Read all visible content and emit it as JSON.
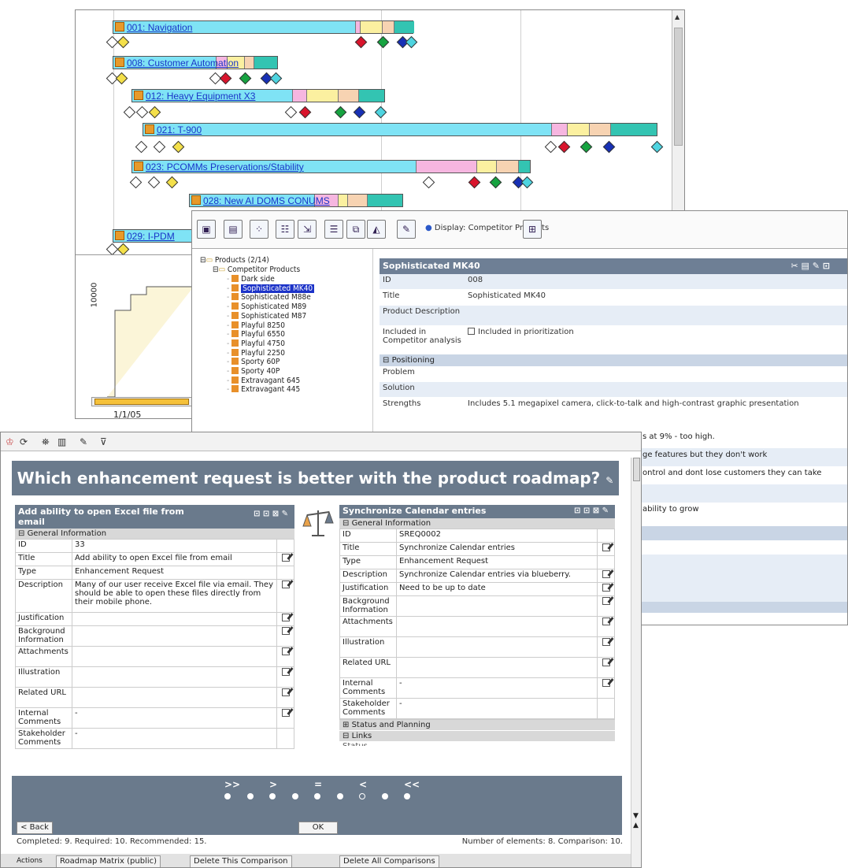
{
  "gantt": {
    "projects": [
      {
        "label": "001: Navigation"
      },
      {
        "label": "008: Customer Automation"
      },
      {
        "label": "012: Heavy Equipment X3"
      },
      {
        "label": "021: T-900"
      },
      {
        "label": "023: PCOMMs Preservations/Stability"
      },
      {
        "label": "028: New AI DOMS CONUMS"
      },
      {
        "label": "029: I-PDM"
      }
    ],
    "chart": {
      "y_tick": "10000",
      "x_tick": "1/1/05"
    },
    "colors": {
      "bar": "#7fe3f5",
      "pink": "#f6b6e0",
      "yellow": "#fbf0a0",
      "peach": "#f7d3b2",
      "teal": "#33c4b2"
    }
  },
  "product_window": {
    "display_label": "Display: Competitor Products",
    "tree": {
      "root": "Products (2/14)",
      "group": "Competitor Products",
      "items": [
        "Dark side",
        "Sophisticated MK40",
        "Sophisticated M88e",
        "Sophisticated M89",
        "Sophisticated M87",
        "Playful 8250",
        "Playful 6550",
        "Playful 4750",
        "Playful 2250",
        "Sporty 60P",
        "Sporty 40P",
        "Extravagant 645",
        "Extravagant 445"
      ],
      "selected_index": 1
    },
    "detail": {
      "title": "Sophisticated MK40",
      "rows": [
        {
          "k": "ID",
          "v": "008"
        },
        {
          "k": "Title",
          "v": "Sophisticated MK40"
        },
        {
          "k": "Product Description",
          "v": ""
        },
        {
          "k": "Included in Competitor analysis",
          "v": "Included in prioritization"
        }
      ],
      "section": "Positioning",
      "rows2": [
        {
          "k": "Problem",
          "v": ""
        },
        {
          "k": "Solution",
          "v": ""
        },
        {
          "k": "Strengths",
          "v": "Includes 5.1 megapixel camera, click-to-talk and high-contrast graphic presentation"
        }
      ],
      "overflow_lines": [
        "s at 9% - too high.",
        "ge features but they don't work",
        "ontrol and dont lose customers they can take",
        "",
        "ability to grow"
      ]
    }
  },
  "compare_window": {
    "question": "Which enhancement request is better with the product roadmap?",
    "left": {
      "title": "Add ability to open Excel file from email",
      "section": "General Information",
      "rows": [
        {
          "k": "ID",
          "v": "33",
          "edit": false
        },
        {
          "k": "Title",
          "v": "Add ability to open Excel file from email",
          "edit": true
        },
        {
          "k": "Type",
          "v": "Enhancement Request",
          "edit": false
        },
        {
          "k": "Description",
          "v": "Many of our user receive Excel file via email. They should be able to open these files directly from their mobile phone.",
          "edit": true
        },
        {
          "k": "Justification",
          "v": "",
          "edit": true
        },
        {
          "k": "Background Information",
          "v": "",
          "edit": true
        },
        {
          "k": "Attachments",
          "v": "",
          "edit": true
        },
        {
          "k": "Illustration",
          "v": "",
          "edit": true
        },
        {
          "k": "Related URL",
          "v": "",
          "edit": true
        },
        {
          "k": "Internal Comments",
          "v": "-",
          "edit": true
        },
        {
          "k": "Stakeholder Comments",
          "v": "-",
          "edit": false
        }
      ]
    },
    "right": {
      "title": "Synchronize Calendar entries",
      "section": "General Information",
      "rows": [
        {
          "k": "ID",
          "v": "SREQ0002",
          "edit": false
        },
        {
          "k": "Title",
          "v": "Synchronize Calendar entries",
          "edit": true
        },
        {
          "k": "Type",
          "v": "Enhancement Request",
          "edit": false
        },
        {
          "k": "Description",
          "v": "Synchronize Calendar entries via blueberry.",
          "edit": true
        },
        {
          "k": "Justification",
          "v": "Need to be up to date",
          "edit": true
        },
        {
          "k": "Background Information",
          "v": "",
          "edit": true
        },
        {
          "k": "Attachments",
          "v": "",
          "edit": true
        },
        {
          "k": "Illustration",
          "v": "",
          "edit": true
        },
        {
          "k": "Related URL",
          "v": "",
          "edit": true
        },
        {
          "k": "Internal Comments",
          "v": "-",
          "edit": true
        },
        {
          "k": "Stakeholder Comments",
          "v": "-",
          "edit": false
        }
      ],
      "sec2": "Status and Planning",
      "sec3": "Links",
      "cut": "Status"
    },
    "nav_labels": [
      ">>",
      ">",
      "=",
      "<",
      "<<"
    ],
    "selected_dot": 6,
    "back_label": "< Back",
    "ok_label": "OK",
    "status": {
      "left": "Completed: 9. Required: 10. Recommended: 15.",
      "right": "Number of elements: 8. Comparison: 10."
    },
    "bottom_tabs": [
      "Roadmap Matrix (public)",
      "Delete This Comparison",
      "Delete All Comparisons"
    ],
    "bottom_left": "Actions"
  }
}
